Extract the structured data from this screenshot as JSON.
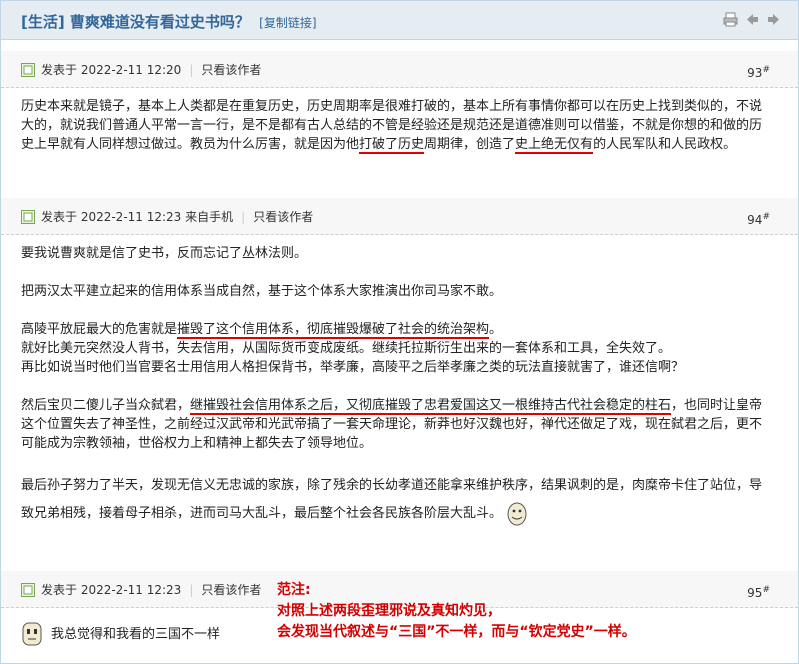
{
  "thread": {
    "title": "[生活] 曹爽难道没有看过史书吗？",
    "copy_link": "[复制链接]"
  },
  "toolbar": {
    "icons": [
      "printer-icon",
      "previous-icon",
      "next-icon"
    ]
  },
  "posts": [
    {
      "meta": "发表于 2022-2-11 12:20",
      "only_author": "只看该作者",
      "floor": "93",
      "floor_mark": "#",
      "body": {
        "t1": "历史本来就是镜子，基本上人类都是在重复历史，历史周期率是很难打破的，基本上所有事情你都可以在历史上找到类似的，不说大的，就说我们普通人平常一言一行，是不是都有古人总结的不管是经验还是规范还是道德准则可以借鉴，不就是你想的和做的历史上早就有人同样想过做过。教员为什么厉害，就是因为他",
        "u1": "打破了历史",
        "t2": "周期律，创造了",
        "u2": "史上绝无仅有",
        "t3": "的人民军队和人民政权。"
      }
    },
    {
      "meta": "发表于 2022-2-11 12:23 来自手机",
      "only_author": "只看该作者",
      "floor": "94",
      "floor_mark": "#",
      "body": {
        "p1": "要我说曹爽就是信了史书，反而忘记了丛林法则。",
        "p2": "把两汉太平建立起来的信用体系当成自然，基于这个体系大家推演出你司马家不敢。",
        "p3a": "高陵平放屁最大的危害就是",
        "p3u": "摧毁了这个信用体系，彻底摧毁爆破了社会的统治架构",
        "p3b": "。",
        "p3c": "就好比美元突然没人背书，失去信用，从国际货币变成废纸。继续托拉斯衍生出来的一套体系和工具，全失效了。",
        "p3d": "再比如说当时他们当官要名士用信用人格担保背书，举孝廉，高陵平之后举孝廉之类的玩法直接就害了，谁还信啊？",
        "p4a": "然后宝贝二傻儿子当众弑君，",
        "p4u": "继摧毁社会信用体系之后，又彻底摧毁了忠君爱国这又一根维持古代社会稳定的柱石",
        "p4b": "，也同时让皇帝这个位置失去了神圣性，之前经过汉武帝和光武帝搞了一套天命理论，新莽也好汉魏也好，禅代还做足了戏，现在弑君之后，更不可能成为宗教领袖，世俗权力上和精神上都失去了领导地位。",
        "p5a": "最后孙子努力了半天，发现无信义无忠诚的家族，除了残余的长幼孝道还能拿来维护秩序，结果讽刺的是，肉糜帝卡住了站位，导致兄弟相残，接着母子相杀，进而司马大乱斗，最后整个社会各民族各阶层大乱斗。"
      }
    },
    {
      "meta": "发表于 2022-2-11 12:23",
      "only_author": "只看该作者",
      "floor": "95",
      "floor_mark": "#",
      "body": {
        "text": "我总觉得和我看的三国不一样"
      }
    }
  ],
  "annotation": {
    "heading": "范注:",
    "line1": "对照上述两段歪理邪说及真知灼见，",
    "line2": "会发现当代叙述与“三国”不一样，而与“钦定党史”一样。"
  },
  "colors": {
    "title": "#336699",
    "header_bg": "#e5edf2",
    "border": "#c2d5e3",
    "underline": "#e00000",
    "annotation": "#d20000"
  }
}
